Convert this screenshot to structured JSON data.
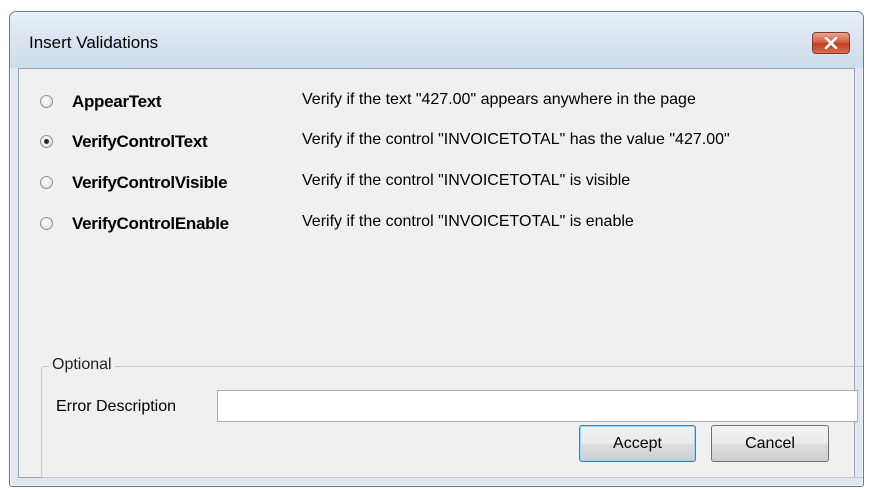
{
  "window": {
    "title": "Insert Validations"
  },
  "options": [
    {
      "label": "AppearText",
      "description": "Verify if the text \"427.00\" appears anywhere in the page",
      "checked": false
    },
    {
      "label": "VerifyControlText",
      "description": "Verify if the control \"INVOICETOTAL\" has the value \"427.00\"",
      "checked": true
    },
    {
      "label": "VerifyControlVisible",
      "description": "Verify if the control \"INVOICETOTAL\" is visible",
      "checked": false
    },
    {
      "label": "VerifyControlEnable",
      "description": "Verify if the control \"INVOICETOTAL\" is enable",
      "checked": false
    }
  ],
  "optional": {
    "group_label": "Optional",
    "error_label": "Error Description",
    "error_value": ""
  },
  "buttons": {
    "accept": "Accept",
    "cancel": "Cancel"
  },
  "icons": {
    "close": "close-icon"
  },
  "colors": {
    "close_button": "#c94a2e",
    "dialog_background": "#f0f0f0"
  }
}
